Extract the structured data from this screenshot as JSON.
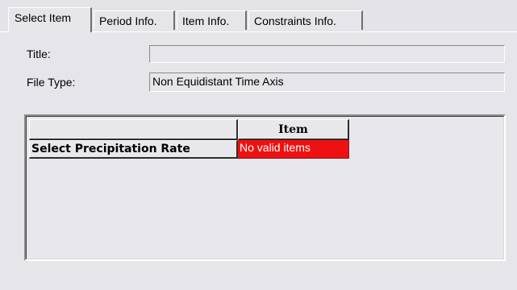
{
  "tabs": [
    {
      "label": "Select Item",
      "active": true
    },
    {
      "label": "Period Info.",
      "active": false
    },
    {
      "label": "Item Info.",
      "active": false
    },
    {
      "label": "Constraints Info.",
      "active": false
    }
  ],
  "form": {
    "title_label": "Title:",
    "title_value": "",
    "file_type_label": "File Type:",
    "file_type_value": "Non Equidistant Time Axis"
  },
  "grid": {
    "column_header": "Item",
    "rows": [
      {
        "label": "Select Precipitation Rate",
        "value": "No valid items",
        "value_color": "#ee1111"
      }
    ]
  }
}
